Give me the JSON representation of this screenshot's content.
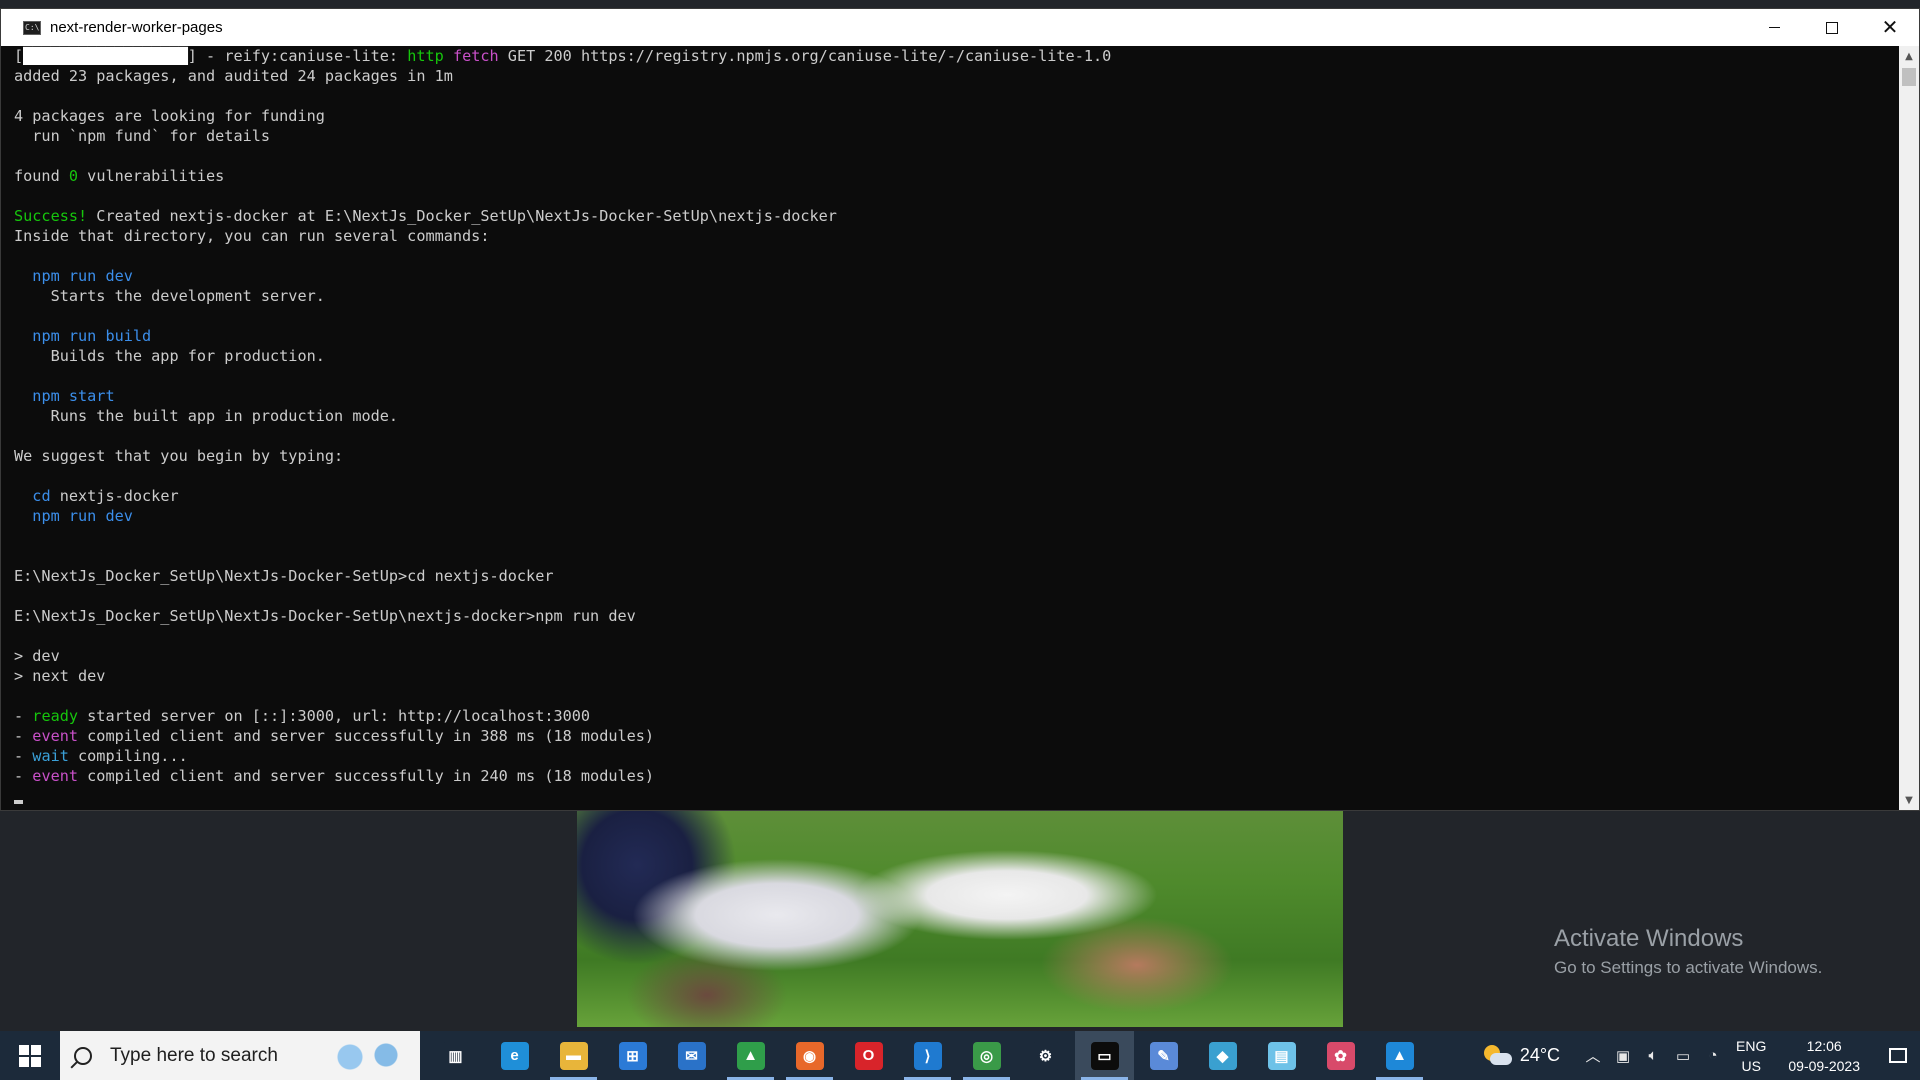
{
  "window": {
    "title": "next-render-worker-pages",
    "controls": {
      "minimize": "minimize-icon",
      "maximize": "maximize-icon",
      "close": "close-icon"
    }
  },
  "console": {
    "lines": [
      [
        {
          "t": "["
        },
        {
          "t": "██████████████████",
          "c": "hi"
        },
        {
          "t": "] - reify:caniuse-lite: "
        },
        {
          "t": "http",
          "c": "green"
        },
        {
          "t": " "
        },
        {
          "t": "fetch",
          "c": "magenta"
        },
        {
          "t": " GET 200 https://registry.npmjs.org/caniuse-lite/-/caniuse-lite-1.0"
        }
      ],
      [
        {
          "t": "added 23 packages, and audited 24 packages in 1m"
        }
      ],
      [],
      [
        {
          "t": "4 packages are looking for funding"
        }
      ],
      [
        {
          "t": "  run `npm fund` for details"
        }
      ],
      [],
      [
        {
          "t": "found "
        },
        {
          "t": "0",
          "c": "green"
        },
        {
          "t": " vulnerabilities"
        }
      ],
      [],
      [
        {
          "t": "Success!",
          "c": "green"
        },
        {
          "t": " Created nextjs-docker at E:\\NextJs_Docker_SetUp\\NextJs-Docker-SetUp\\nextjs-docker"
        }
      ],
      [
        {
          "t": "Inside that directory, you can run several commands:"
        }
      ],
      [],
      [
        {
          "t": "  "
        },
        {
          "t": "npm run dev",
          "c": "blue"
        }
      ],
      [
        {
          "t": "    Starts the development server."
        }
      ],
      [],
      [
        {
          "t": "  "
        },
        {
          "t": "npm run build",
          "c": "blue"
        }
      ],
      [
        {
          "t": "    Builds the app for production."
        }
      ],
      [],
      [
        {
          "t": "  "
        },
        {
          "t": "npm start",
          "c": "blue"
        }
      ],
      [
        {
          "t": "    Runs the built app in production mode."
        }
      ],
      [],
      [
        {
          "t": "We suggest that you begin by typing:"
        }
      ],
      [],
      [
        {
          "t": "  "
        },
        {
          "t": "cd",
          "c": "blue"
        },
        {
          "t": " nextjs-docker"
        }
      ],
      [
        {
          "t": "  "
        },
        {
          "t": "npm run dev",
          "c": "blue"
        }
      ],
      [],
      [],
      [
        {
          "t": "E:\\NextJs_Docker_SetUp\\NextJs-Docker-SetUp>cd nextjs-docker"
        }
      ],
      [],
      [
        {
          "t": "E:\\NextJs_Docker_SetUp\\NextJs-Docker-SetUp\\nextjs-docker>npm run dev"
        }
      ],
      [],
      [
        {
          "t": "> dev"
        }
      ],
      [
        {
          "t": "> next dev"
        }
      ],
      [],
      [
        {
          "t": "- "
        },
        {
          "t": "ready",
          "c": "green"
        },
        {
          "t": " started server on [::]:3000, url: http://localhost:3000"
        }
      ],
      [
        {
          "t": "- "
        },
        {
          "t": "event",
          "c": "magenta"
        },
        {
          "t": " compiled client and server successfully in 388 ms (18 modules)"
        }
      ],
      [
        {
          "t": "- "
        },
        {
          "t": "wait",
          "c": "cyan"
        },
        {
          "t": " compiling..."
        }
      ],
      [
        {
          "t": "- "
        },
        {
          "t": "event",
          "c": "magenta"
        },
        {
          "t": " compiled client and server successfully in 240 ms (18 modules)"
        }
      ],
      [
        {
          "cursor": true
        }
      ]
    ]
  },
  "desktop": {
    "activate_title": "Activate Windows",
    "activate_subtitle": "Go to Settings to activate Windows."
  },
  "taskbar": {
    "search_placeholder": "Type here to search",
    "apps": [
      {
        "name": "task-view",
        "icon": "task-view-icon",
        "color": "#1c2a3a",
        "glyph": "▥",
        "open": false
      },
      {
        "name": "edge",
        "icon": "edge-icon",
        "color": "#1f8fd8",
        "glyph": "e",
        "open": false
      },
      {
        "name": "file-explorer",
        "icon": "folder-icon",
        "color": "#e8b53a",
        "glyph": "▬",
        "open": true
      },
      {
        "name": "microsoft-store",
        "icon": "store-icon",
        "color": "#2b7ad6",
        "glyph": "⊞",
        "open": false
      },
      {
        "name": "mail",
        "icon": "mail-icon",
        "color": "#2a72c8",
        "glyph": "✉",
        "open": false
      },
      {
        "name": "image-editor",
        "icon": "picture-icon",
        "color": "#2f9e4a",
        "glyph": "▲",
        "open": true
      },
      {
        "name": "firefox",
        "icon": "firefox-icon",
        "color": "#e8682a",
        "glyph": "◉",
        "open": true
      },
      {
        "name": "opera",
        "icon": "opera-icon",
        "color": "#d8242a",
        "glyph": "O",
        "open": false
      },
      {
        "name": "vscode",
        "icon": "vscode-icon",
        "color": "#1f7ad0",
        "glyph": "⟩",
        "open": true
      },
      {
        "name": "chrome",
        "icon": "chrome-icon",
        "color": "#3a9a48",
        "glyph": "◎",
        "open": true
      },
      {
        "name": "settings",
        "icon": "gear-icon",
        "color": "#1c2a3a",
        "glyph": "⚙",
        "open": false
      },
      {
        "name": "terminal",
        "icon": "terminal-icon",
        "color": "#0c0c0c",
        "glyph": "▭",
        "open": true,
        "active": true
      },
      {
        "name": "paint",
        "icon": "paint-icon",
        "color": "#5a8ad8",
        "glyph": "✎",
        "open": false
      },
      {
        "name": "git-tool",
        "icon": "git-icon",
        "color": "#3aa0d0",
        "glyph": "◆",
        "open": false
      },
      {
        "name": "notepad",
        "icon": "notepad-icon",
        "color": "#6ec2e8",
        "glyph": "▤",
        "open": false
      },
      {
        "name": "paint-3d",
        "icon": "paint-3d-icon",
        "color": "#d84a6a",
        "glyph": "✿",
        "open": false
      },
      {
        "name": "photos",
        "icon": "photos-icon",
        "color": "#1e88d8",
        "glyph": "▲",
        "open": true
      }
    ],
    "weather_temp": "24°C",
    "tray_icons": [
      "chevron-up-icon",
      "meet-now-icon",
      "speaker-icon",
      "battery-icon",
      "wifi-icon"
    ],
    "language_line1": "ENG",
    "language_line2": "US",
    "time": "12:06",
    "date": "09-09-2023"
  }
}
